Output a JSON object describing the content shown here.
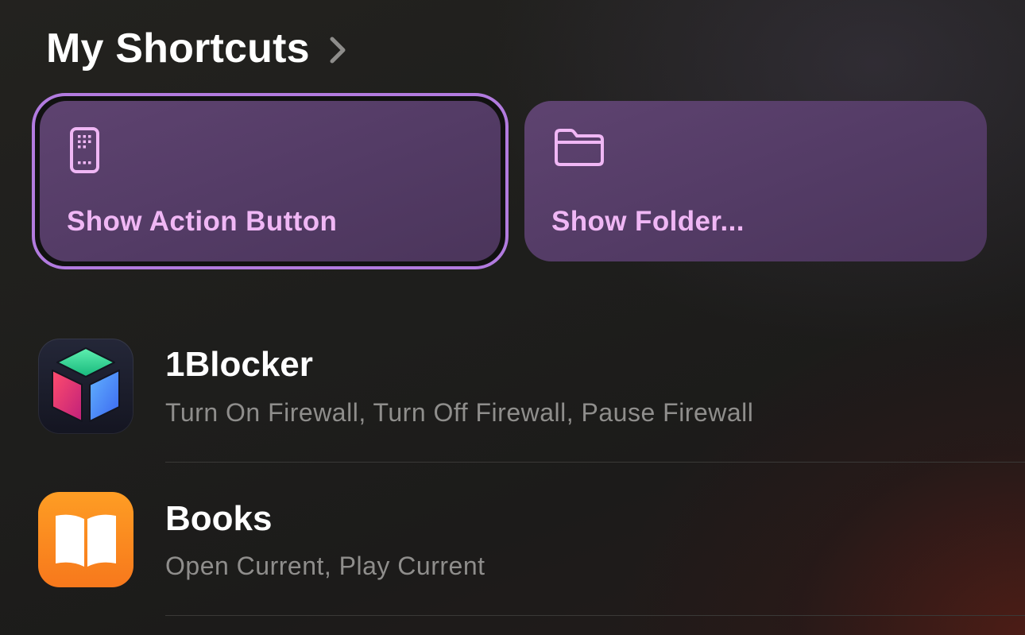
{
  "header": {
    "title": "My Shortcuts",
    "chevron_icon": "chevron-right-icon"
  },
  "shortcuts": [
    {
      "label": "Show Action Button",
      "icon": "action-button-phone-icon",
      "selected": true
    },
    {
      "label": "Show Folder...",
      "icon": "folder-icon",
      "selected": false
    }
  ],
  "apps": [
    {
      "name": "1Blocker",
      "actions": "Turn On Firewall, Turn Off Firewall, Pause Firewall",
      "icon": "1blocker-app-icon"
    },
    {
      "name": "Books",
      "actions": "Open Current, Play Current",
      "icon": "books-app-icon"
    }
  ],
  "colors": {
    "card_background": "#563c68",
    "card_label": "#f0b7f5",
    "selection_ring": "#b27bdf",
    "subtitle": "#8f8e8c",
    "books_orange": "#fd8a21"
  }
}
